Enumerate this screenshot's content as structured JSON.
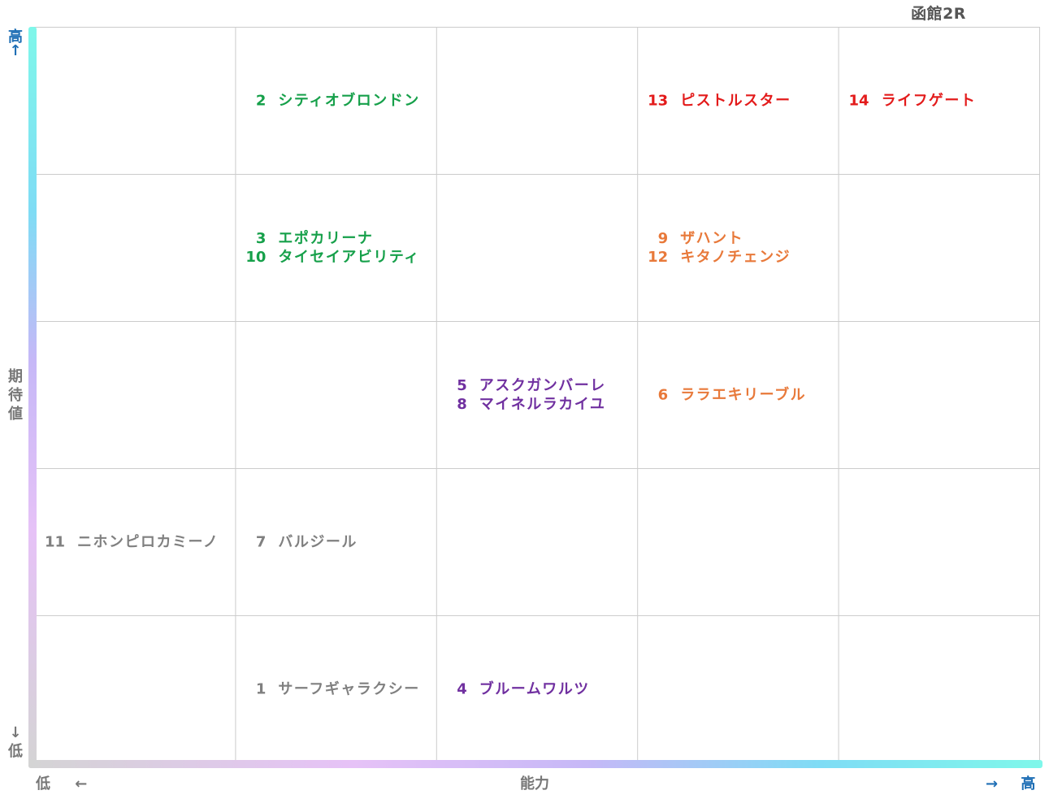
{
  "title": "函館2R",
  "axes": {
    "y_label": "期待値",
    "y_high": "高",
    "y_low": "低",
    "x_label": "能力",
    "x_high": "高",
    "x_low": "低",
    "arrow_up": "↑",
    "arrow_down": "↓",
    "arrow_left": "←",
    "arrow_right": "→",
    "axis_label_color": "#777777",
    "high_color": "#1f6fb5"
  },
  "chart_data": {
    "type": "table",
    "x_axis": "能力",
    "y_axis": "期待値",
    "columns": 5,
    "rows": 5,
    "cells": [
      {
        "col": 2,
        "row": 1,
        "color": "#16a04a",
        "entries": [
          {
            "num": "2",
            "name": "シティオブロンドン"
          }
        ]
      },
      {
        "col": 4,
        "row": 1,
        "color": "#e31b1b",
        "entries": [
          {
            "num": "13",
            "name": "ピストルスター"
          }
        ]
      },
      {
        "col": 5,
        "row": 1,
        "color": "#e31b1b",
        "entries": [
          {
            "num": "14",
            "name": "ライフゲート"
          }
        ]
      },
      {
        "col": 2,
        "row": 2,
        "color": "#16a04a",
        "entries": [
          {
            "num": "3",
            "name": "エポカリーナ"
          },
          {
            "num": "10",
            "name": "タイセイアビリティ"
          }
        ]
      },
      {
        "col": 4,
        "row": 2,
        "color": "#e8793a",
        "entries": [
          {
            "num": "9",
            "name": "ザハント"
          },
          {
            "num": "12",
            "name": "キタノチェンジ"
          }
        ]
      },
      {
        "col": 3,
        "row": 3,
        "color": "#7030a0",
        "entries": [
          {
            "num": "5",
            "name": "アスクガンバーレ"
          },
          {
            "num": "8",
            "name": "マイネルラカイユ"
          }
        ]
      },
      {
        "col": 4,
        "row": 3,
        "color": "#e8793a",
        "entries": [
          {
            "num": "6",
            "name": "ララエキリーブル"
          }
        ]
      },
      {
        "col": 1,
        "row": 4,
        "color": "#808080",
        "entries": [
          {
            "num": "11",
            "name": "ニホンピロカミーノ"
          }
        ]
      },
      {
        "col": 2,
        "row": 4,
        "color": "#808080",
        "entries": [
          {
            "num": "7",
            "name": "バルジール"
          }
        ]
      },
      {
        "col": 2,
        "row": 5,
        "color": "#808080",
        "entries": [
          {
            "num": "1",
            "name": "サーフギャラクシー"
          }
        ]
      },
      {
        "col": 3,
        "row": 5,
        "color": "#7030a0",
        "entries": [
          {
            "num": "4",
            "name": "ブルームワルツ"
          }
        ]
      }
    ]
  }
}
